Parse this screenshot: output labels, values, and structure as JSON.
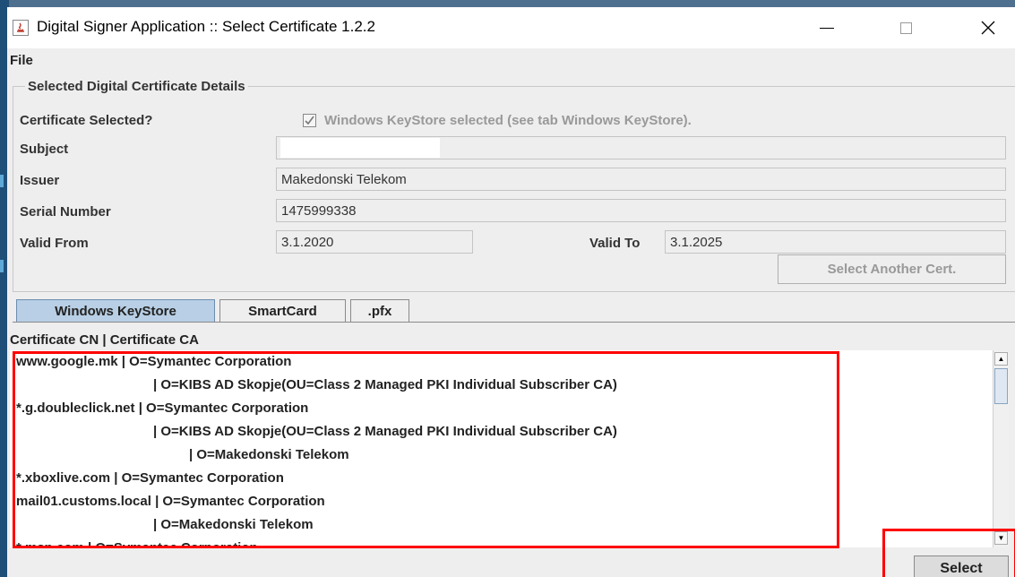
{
  "window": {
    "title": "Digital Signer Application  :: Select Certificate  1.2.2"
  },
  "menu": {
    "file": "File"
  },
  "details": {
    "group_title": "Selected Digital Certificate Details",
    "cert_selected_label": "Certificate Selected?",
    "cert_selected_text": "Windows KeyStore selected (see tab Windows KeyStore).",
    "subject_label": "Subject",
    "subject_value": "",
    "issuer_label": "Issuer",
    "issuer_value": "Makedonski Telekom",
    "serial_label": "Serial Number",
    "serial_value": "1475999338",
    "valid_from_label": "Valid From",
    "valid_from_value": "3.1.2020",
    "valid_to_label": "Valid To",
    "valid_to_value": "3.1.2025",
    "another_button": "Select Another Cert."
  },
  "tabs": [
    "Windows KeyStore",
    "SmartCard",
    ".pfx"
  ],
  "list": {
    "header": "Certificate CN | Certificate CA",
    "rows": [
      "www.google.mk | O=Symantec Corporation",
      "| O=KIBS AD Skopje(OU=Class 2 Managed PKI Individual Subscriber CA)",
      "*.g.doubleclick.net | O=Symantec Corporation",
      "| O=KIBS AD Skopje(OU=Class 2 Managed PKI Individual Subscriber CA)",
      "| O=Makedonski Telekom",
      "*.xboxlive.com | O=Symantec Corporation",
      "mail01.customs.local | O=Symantec Corporation",
      "| O=Makedonski Telekom",
      "*.msn.com | O=Symantec Corporation"
    ]
  },
  "select_button": "Select",
  "colors": {
    "highlight": "#ff0000",
    "active_tab": "#b8cfe5"
  }
}
